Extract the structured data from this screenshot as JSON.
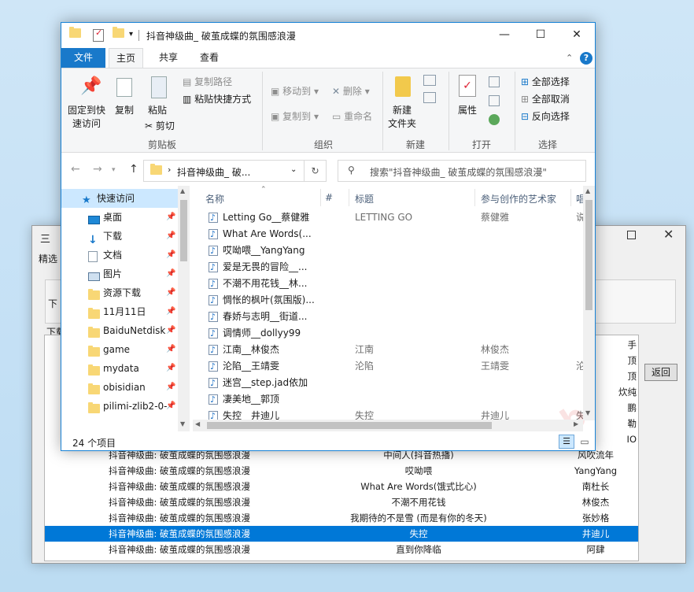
{
  "background_window": {
    "title": "三",
    "menu_label": "精选",
    "panel_label": "下",
    "group_label": "下载",
    "back_button": "返回",
    "rows": [
      {
        "c1": "",
        "c2": "",
        "c3": "手"
      },
      {
        "c1": "",
        "c2": "",
        "c3": "顶"
      },
      {
        "c1": "",
        "c2": "",
        "c3": "顶"
      },
      {
        "c1": "",
        "c2": "",
        "c3": "炊纯"
      },
      {
        "c1": "",
        "c2": "",
        "c3": "鹏"
      },
      {
        "c1": "",
        "c2": "",
        "c3": "勒"
      },
      {
        "c1": "",
        "c2": "",
        "c3": "IO"
      },
      {
        "c1": "抖音神级曲: 破茧成蝶的氛围感浪漫",
        "c2": "中间人(抖音热播)",
        "c3": "风吹流年"
      },
      {
        "c1": "抖音神级曲: 破茧成蝶的氛围感浪漫",
        "c2": "哎呦喂",
        "c3": "YangYang"
      },
      {
        "c1": "抖音神级曲: 破茧成蝶的氛围感浪漫",
        "c2": "What Are Words(饿式比心)",
        "c3": "南杜长"
      },
      {
        "c1": "抖音神级曲: 破茧成蝶的氛围感浪漫",
        "c2": "不潮不用花钱",
        "c3": "林俊杰"
      },
      {
        "c1": "抖音神级曲: 破茧成蝶的氛围感浪漫",
        "c2": "我期待的不是雪 (而是有你的冬天)",
        "c3": "张妙格"
      },
      {
        "c1": "抖音神级曲: 破茧成蝶的氛围感浪漫",
        "c2": "失控",
        "c3": "井迪儿"
      },
      {
        "c1": "抖音神级曲: 破茧成蝶的氛围感浪漫",
        "c2": "直到你降临",
        "c3": "阿肆"
      }
    ],
    "selected_row": 12
  },
  "explorer": {
    "title": "抖音神级曲_ 破茧成蝶的氛围感浪漫",
    "tabs": [
      "文件",
      "主页",
      "共享",
      "查看"
    ],
    "ribbon": {
      "pin": "固定到快\n速访问",
      "pin_l1": "固定到快",
      "pin_l2": "速访问",
      "copy": "复制",
      "paste": "粘贴",
      "copy_path": "复制路径",
      "paste_shortcut": "粘贴快捷方式",
      "cut": "剪切",
      "clipboard_group": "剪贴板",
      "move_to": "移动到",
      "copy_to": "复制到",
      "delete": "删除",
      "rename": "重命名",
      "organize_group": "组织",
      "new_folder_l1": "新建",
      "new_folder_l2": "文件夹",
      "new_group": "新建",
      "properties": "属性",
      "open_group": "打开",
      "select_all": "全部选择",
      "select_none": "全部取消",
      "invert_selection": "反向选择",
      "select_group": "选择"
    },
    "address": "抖音神级曲_ 破...",
    "search_placeholder": "搜索\"抖音神级曲_ 破茧成蝶的氛围感浪漫\"",
    "nav": [
      {
        "label": "快速访问",
        "icon": "star-icon",
        "pinned": false
      },
      {
        "label": "桌面",
        "icon": "desktop-icon",
        "pinned": true
      },
      {
        "label": "下载",
        "icon": "download-icon",
        "pinned": true
      },
      {
        "label": "文档",
        "icon": "document-icon",
        "pinned": true
      },
      {
        "label": "图片",
        "icon": "picture-icon",
        "pinned": true
      },
      {
        "label": "资源下载",
        "icon": "folder-icon",
        "pinned": true
      },
      {
        "label": "11月11日",
        "icon": "folder-icon",
        "pinned": true
      },
      {
        "label": "BaiduNetdisk",
        "icon": "folder-icon",
        "pinned": true
      },
      {
        "label": "game",
        "icon": "folder-icon",
        "pinned": true
      },
      {
        "label": "mydata",
        "icon": "folder-icon",
        "pinned": true
      },
      {
        "label": "obisidian",
        "icon": "folder-icon",
        "pinned": true
      },
      {
        "label": "pilimi-zlib2-0-",
        "icon": "folder-icon",
        "pinned": true
      }
    ],
    "columns": [
      "名称",
      "#",
      "标题",
      "参与创作的艺术家",
      "唱"
    ],
    "files": [
      {
        "name": "Letting Go__蔡健雅",
        "title": "LETTING GO",
        "artist": "蔡健雅",
        "extra": "说"
      },
      {
        "name": "What Are Words(...",
        "title": "",
        "artist": "",
        "extra": ""
      },
      {
        "name": "哎呦喂__YangYang",
        "title": "",
        "artist": "",
        "extra": ""
      },
      {
        "name": "爱是无畏的冒险__...",
        "title": "",
        "artist": "",
        "extra": ""
      },
      {
        "name": "不潮不用花钱__林...",
        "title": "",
        "artist": "",
        "extra": ""
      },
      {
        "name": "惆怅的枫叶(氛围版)...",
        "title": "",
        "artist": "",
        "extra": ""
      },
      {
        "name": "春娇与志明__街道...",
        "title": "",
        "artist": "",
        "extra": ""
      },
      {
        "name": "调情师__dollyy99",
        "title": "",
        "artist": "",
        "extra": ""
      },
      {
        "name": "江南__林俊杰",
        "title": "江南",
        "artist": "林俊杰",
        "extra": ""
      },
      {
        "name": "沦陷__王靖雯",
        "title": "沦陷",
        "artist": "王靖雯",
        "extra": "沦"
      },
      {
        "name": "迷宫__step.jad依加",
        "title": "",
        "artist": "",
        "extra": ""
      },
      {
        "name": "凄美地__郭顶",
        "title": "",
        "artist": "",
        "extra": ""
      },
      {
        "name": "失控__井迪儿",
        "title": "失控",
        "artist": "井迪儿",
        "extra": "失"
      }
    ],
    "status": "24 个项目",
    "accent": "#1979ca",
    "selection": "#cce8ff"
  }
}
